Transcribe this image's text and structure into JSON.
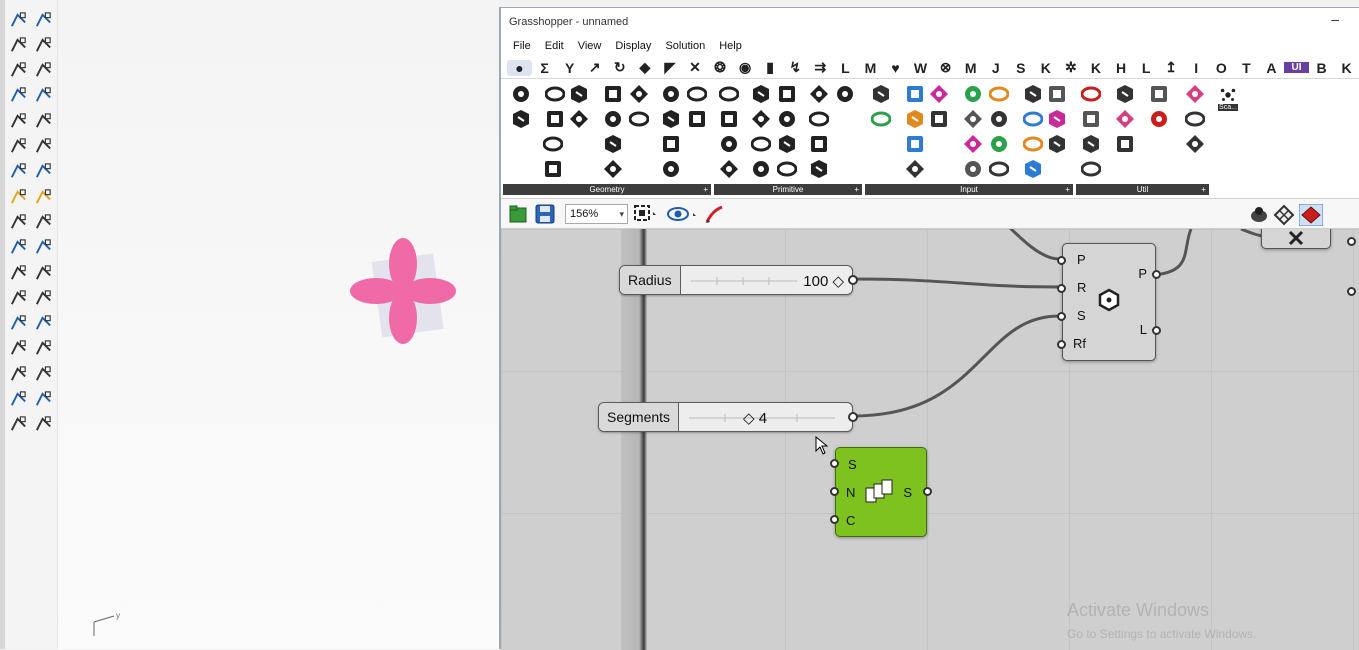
{
  "window": {
    "title": "Grasshopper - unnamed",
    "minimize_glyph": "–"
  },
  "menu": [
    "File",
    "Edit",
    "View",
    "Display",
    "Solution",
    "Help"
  ],
  "component_tabs": [
    "●",
    "Σ",
    "Y",
    "↗",
    "↻",
    "◆",
    "◤",
    "✕",
    "❂",
    "◉",
    "▮",
    "↯",
    "⇉",
    "L",
    "M",
    "♥",
    "W",
    "⊗",
    "M",
    "J",
    "S",
    "K",
    "✲",
    "K",
    "H",
    "L",
    "↥",
    "I",
    "O",
    "T",
    "A",
    "UI",
    "B",
    "K"
  ],
  "ribbon": {
    "panels": [
      {
        "label": "Geometry"
      },
      {
        "label": "Primitive"
      },
      {
        "label": "Input"
      },
      {
        "label": "Util"
      }
    ],
    "overflow_label": "Sca..."
  },
  "toolbar2": {
    "zoom": "156%"
  },
  "canvas": {
    "radius_slider": {
      "label": "Radius",
      "value": "100 ◇"
    },
    "segments_slider": {
      "label": "Segments",
      "value": "◇ 4"
    },
    "polygon_component": {
      "inputs": [
        "P",
        "R",
        "S",
        "Rf"
      ],
      "outputs": [
        "P",
        "L"
      ]
    },
    "series_component": {
      "inputs": [
        "S",
        "N",
        "C"
      ],
      "outputs": [
        "S"
      ]
    }
  },
  "watermark": {
    "line1": "Activate Windows",
    "line2": "Go to Settings to activate Windows."
  },
  "colors": {
    "series_green": "#7dc21e",
    "flower_pink": "#f06aa8",
    "canvas_gray": "#cfcfcf"
  }
}
